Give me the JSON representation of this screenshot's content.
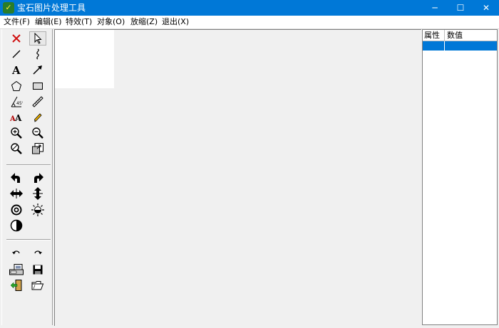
{
  "window": {
    "title": "宝石图片处理工具",
    "app_icon_glyph": "✓",
    "minimize_glyph": "─",
    "maximize_glyph": "☐",
    "close_glyph": "✕",
    "accent_color": "#0078d7"
  },
  "menu": {
    "items": [
      {
        "label": "文件(F)"
      },
      {
        "label": "编辑(E)"
      },
      {
        "label": "特效(T)"
      },
      {
        "label": "对象(O)"
      },
      {
        "label": "放缩(Z)"
      },
      {
        "label": "退出(X)"
      }
    ]
  },
  "toolbox": {
    "tools": [
      "delete-icon",
      "pointer-icon",
      "line-icon",
      "curve-icon",
      "text-icon",
      "arrow-icon",
      "polygon-icon",
      "rectangle-icon",
      "angle-measure-icon",
      "ruler-icon",
      "font-size-icon",
      "pencil-icon",
      "zoom-in-icon",
      "zoom-out-icon",
      "zoom-reset-icon",
      "resize-icon",
      "rotate-left-icon",
      "rotate-right-icon",
      "flip-horizontal-icon",
      "flip-vertical-icon",
      "contrast-icon",
      "brightness-icon",
      "invert-icon",
      "undo-icon",
      "redo-icon",
      "scanner-icon",
      "save-icon",
      "import-icon",
      "open-folder-icon"
    ],
    "selected_tool": "pointer-icon"
  },
  "properties": {
    "columns": [
      "属性",
      "数值"
    ],
    "row_selected_color": "#0078d7"
  }
}
